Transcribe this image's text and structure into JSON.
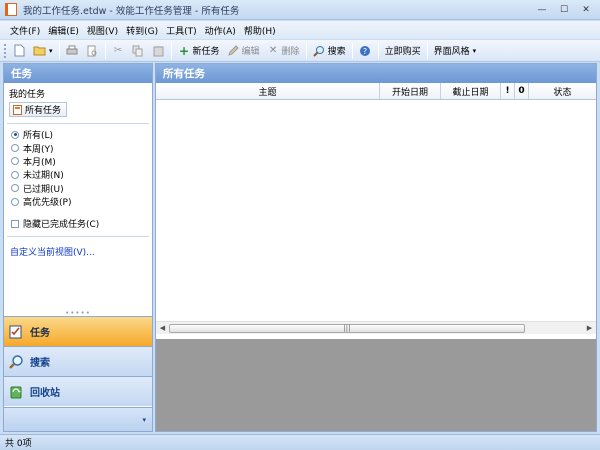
{
  "window": {
    "title": "我的工作任务.etdw - 效能工作任务管理 - 所有任务",
    "controls": [
      "minimize",
      "maximize",
      "close"
    ]
  },
  "menu": [
    "文件(F)",
    "编辑(E)",
    "视图(V)",
    "转到(G)",
    "工具(T)",
    "动作(A)",
    "帮助(H)"
  ],
  "toolbar": {
    "new_task": "新任务",
    "edit": "编辑",
    "delete": "删除",
    "search": "搜索",
    "buy_now": "立即购买",
    "skin": "界面风格"
  },
  "left_panel": {
    "header": "任务",
    "section_title": "我的任务",
    "all_tasks_button": "所有任务",
    "filters": [
      {
        "label": "所有(L)",
        "selected": true
      },
      {
        "label": "本周(Y)",
        "selected": false
      },
      {
        "label": "本月(M)",
        "selected": false
      },
      {
        "label": "未过期(N)",
        "selected": false
      },
      {
        "label": "已过期(U)",
        "selected": false
      },
      {
        "label": "高优先级(P)",
        "selected": false
      }
    ],
    "hide_completed": "隐藏已完成任务(C)",
    "custom_view_link": "自定义当前视图(V)...",
    "nav": {
      "tasks": "任务",
      "search": "搜索",
      "recycle": "回收站"
    }
  },
  "right_panel": {
    "header": "所有任务",
    "columns": [
      "主题",
      "开始日期",
      "截止日期",
      "!",
      "0",
      "状态"
    ]
  },
  "status": {
    "count_text": "共 0项"
  },
  "colors": {
    "accent_orange": "#f6a829",
    "header_blue": "#6d98d4",
    "frame_blue": "#c9ddf3",
    "preview_gray": "#9a9a9a",
    "link_blue": "#0a36c7"
  }
}
